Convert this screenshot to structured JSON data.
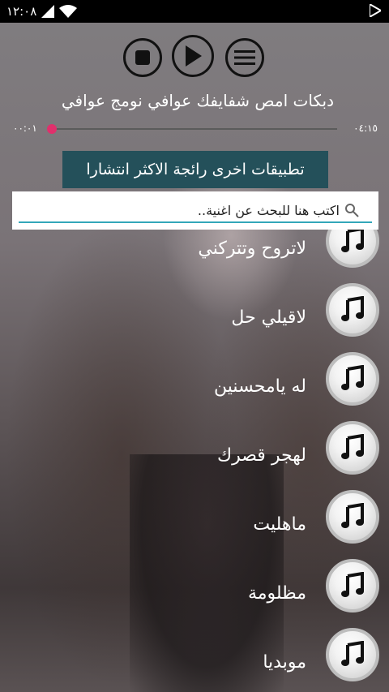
{
  "status_bar": {
    "time": "١٢:٠٨"
  },
  "player": {
    "song_title": "دبكات امص شفايفك عوافي نومج عوافي",
    "elapsed": "٠٠:٠١",
    "duration": "٠٤:١٥",
    "progress": 0.0
  },
  "other_apps_label": "تطبيقات اخرى رائجة الاكثر انتشارا",
  "search": {
    "placeholder": "اكتب هنا للبحث عن اغنية..",
    "value": ""
  },
  "songs": [
    {
      "title": "لاتروح وتتركني"
    },
    {
      "title": "لاقيلي حل"
    },
    {
      "title": "له يامحسنين"
    },
    {
      "title": "لهجر قصرك"
    },
    {
      "title": "ماهليت"
    },
    {
      "title": "مظلومة"
    },
    {
      "title": "موبديا"
    }
  ],
  "colors": {
    "accent": "#e0306c",
    "button_bg": "#24505a",
    "search_underline": "#33a7b9"
  }
}
